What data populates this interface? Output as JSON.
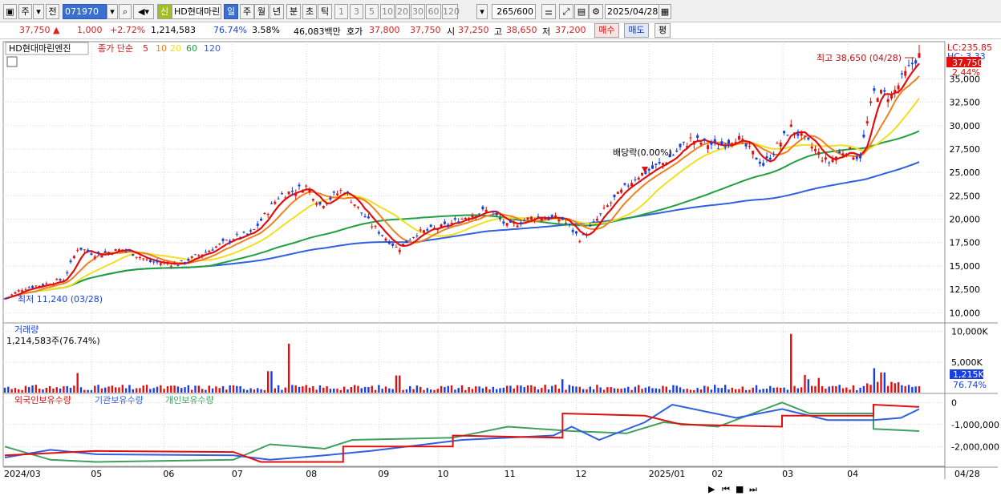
{
  "toolbar": {
    "period_label": "주",
    "prev_label": "전",
    "code": "071970",
    "stock_name": "HD현대마린",
    "badge_new": "신",
    "tabs": [
      "일",
      "주",
      "월",
      "년",
      "분",
      "초",
      "틱"
    ],
    "active_tab": "일",
    "intervals": [
      "1",
      "3",
      "5",
      "10",
      "20",
      "30",
      "60",
      "120"
    ],
    "count": "265",
    "count_total": "/600",
    "date": "2025/04/28"
  },
  "quote": {
    "price": "37,750",
    "change_arrow": "▲",
    "change": "1,000",
    "change_pct": "+2.72%",
    "volume": "1,214,583",
    "vol_ratio": "76.74%",
    "turnover": "3.58%",
    "amount": "46,083백만",
    "bid_label": "호가",
    "ask": "37,800",
    "bid": "37,750",
    "open_label": "시",
    "open": "37,250",
    "high_label": "고",
    "high": "38,650",
    "low_label": "저",
    "low": "37,200",
    "buy_button": "매수",
    "sell_button": "매도",
    "eval_button": "평"
  },
  "legend": {
    "title": "HD현대마린엔진",
    "ma_label": "종가 단순",
    "ma_periods": [
      "5",
      "10",
      "20",
      "60",
      "120"
    ],
    "ma_colors": [
      "#e01010",
      "#f08020",
      "#f0e020",
      "#20a040",
      "#3060e0"
    ]
  },
  "colors": {
    "up": "#e01010",
    "down": "#1a3fe0",
    "grid": "#d8d8d8",
    "foreign": "#e01010",
    "institution": "#3060e0",
    "individual": "#40a060"
  },
  "chart_data": [
    {
      "type": "candlestick",
      "title": "HD현대마린엔진",
      "ylim": [
        9000,
        38800
      ],
      "yticks": [
        "35,000",
        "32,500",
        "30,000",
        "27,500",
        "25,000",
        "22,500",
        "20,000",
        "17,500",
        "15,000",
        "12,500",
        "10,000"
      ],
      "ytick_values": [
        35000,
        32500,
        30000,
        27500,
        25000,
        22500,
        20000,
        17500,
        15000,
        12500,
        10000
      ],
      "x_months": [
        "2024/03",
        "05",
        "06",
        "07",
        "08",
        "09",
        "10",
        "11",
        "12",
        "2025/01",
        "02",
        "03",
        "04"
      ],
      "x_month_pos": [
        0.0,
        0.095,
        0.174,
        0.249,
        0.33,
        0.409,
        0.474,
        0.547,
        0.625,
        0.705,
        0.774,
        0.851,
        0.922
      ],
      "end_label": "04/28",
      "anchors": [
        [
          0.0,
          11500
        ],
        [
          0.02,
          12600
        ],
        [
          0.045,
          13100
        ],
        [
          0.065,
          13600
        ],
        [
          0.08,
          17000
        ],
        [
          0.1,
          16200
        ],
        [
          0.13,
          16800
        ],
        [
          0.16,
          15400
        ],
        [
          0.19,
          15200
        ],
        [
          0.22,
          16500
        ],
        [
          0.25,
          18000
        ],
        [
          0.27,
          18500
        ],
        [
          0.3,
          22500
        ],
        [
          0.33,
          23500
        ],
        [
          0.345,
          21500
        ],
        [
          0.37,
          23200
        ],
        [
          0.4,
          19500
        ],
        [
          0.43,
          16800
        ],
        [
          0.45,
          18500
        ],
        [
          0.48,
          19200
        ],
        [
          0.51,
          20500
        ],
        [
          0.53,
          21000
        ],
        [
          0.55,
          19200
        ],
        [
          0.58,
          20300
        ],
        [
          0.61,
          20000
        ],
        [
          0.63,
          17800
        ],
        [
          0.66,
          21500
        ],
        [
          0.69,
          24500
        ],
        [
          0.72,
          26000
        ],
        [
          0.75,
          28500
        ],
        [
          0.78,
          27800
        ],
        [
          0.8,
          28800
        ],
        [
          0.83,
          25800
        ],
        [
          0.86,
          29800
        ],
        [
          0.88,
          28000
        ],
        [
          0.9,
          26000
        ],
        [
          0.92,
          27500
        ],
        [
          0.935,
          26500
        ],
        [
          0.95,
          33500
        ],
        [
          0.97,
          33200
        ],
        [
          0.985,
          35500
        ],
        [
          1.0,
          37750
        ]
      ],
      "high": "38,650",
      "high_date": "04/28",
      "high_label": "최고 38,650 (04/28)",
      "low": "11,240",
      "low_date": "03/28",
      "low_label": "최저 11,240 (03/28)",
      "annotation": "배당락(0.00%)",
      "right_labels": [
        "LC:235.85",
        "HC: 3.33",
        "37,750",
        "2.44%"
      ]
    },
    {
      "type": "bar",
      "title": "거래량",
      "current": "1,214,583주(76.74%)",
      "yticks": [
        "10,000K",
        "5,000K"
      ],
      "ytick_values": [
        10000,
        5000
      ],
      "ylim": [
        0,
        11000
      ],
      "spikes": [
        [
          0.08,
          3200
        ],
        [
          0.31,
          8000
        ],
        [
          0.29,
          3500
        ],
        [
          0.43,
          2800
        ],
        [
          0.61,
          2200
        ],
        [
          0.86,
          9600
        ],
        [
          0.875,
          2900
        ],
        [
          0.89,
          2400
        ],
        [
          0.95,
          3500
        ],
        [
          0.96,
          2800
        ],
        [
          0.88,
          2200
        ]
      ],
      "current_value": "1,215K",
      "current_pct": "76.74%"
    },
    {
      "type": "line",
      "title": "외국인보유수량",
      "series_names": [
        "외국인보유수량",
        "기관보유수량",
        "개인보유수량"
      ],
      "yticks": [
        "0",
        "-1,000,000",
        "-2,000,000"
      ],
      "ytick_values": [
        0,
        -1000000,
        -2000000
      ],
      "ylim": [
        -2900000,
        300000
      ],
      "foreign": [
        [
          0.0,
          -2400000
        ],
        [
          0.1,
          -2200000
        ],
        [
          0.25,
          -2250000
        ],
        [
          0.28,
          -2700000
        ],
        [
          0.37,
          -2700000
        ],
        [
          0.37,
          -2000000
        ],
        [
          0.49,
          -2000000
        ],
        [
          0.49,
          -1500000
        ],
        [
          0.61,
          -1600000
        ],
        [
          0.61,
          -500000
        ],
        [
          0.7,
          -600000
        ],
        [
          0.74,
          -1000000
        ],
        [
          0.85,
          -1100000
        ],
        [
          0.85,
          -600000
        ],
        [
          0.95,
          -600000
        ],
        [
          0.95,
          -100000
        ],
        [
          1.0,
          -200000
        ]
      ],
      "institution": [
        [
          0.0,
          -2500000
        ],
        [
          0.05,
          -2150000
        ],
        [
          0.1,
          -2350000
        ],
        [
          0.25,
          -2400000
        ],
        [
          0.29,
          -2600000
        ],
        [
          0.35,
          -2400000
        ],
        [
          0.4,
          -2200000
        ],
        [
          0.5,
          -1700000
        ],
        [
          0.6,
          -1500000
        ],
        [
          0.62,
          -1100000
        ],
        [
          0.65,
          -1700000
        ],
        [
          0.7,
          -900000
        ],
        [
          0.73,
          -100000
        ],
        [
          0.8,
          -700000
        ],
        [
          0.85,
          -300000
        ],
        [
          0.9,
          -800000
        ],
        [
          0.95,
          -800000
        ],
        [
          0.98,
          -700000
        ],
        [
          1.0,
          -300000
        ]
      ],
      "individual": [
        [
          0.0,
          -2000000
        ],
        [
          0.05,
          -2600000
        ],
        [
          0.1,
          -2700000
        ],
        [
          0.25,
          -2600000
        ],
        [
          0.29,
          -1900000
        ],
        [
          0.35,
          -2100000
        ],
        [
          0.38,
          -1700000
        ],
        [
          0.49,
          -1600000
        ],
        [
          0.55,
          -1100000
        ],
        [
          0.62,
          -1300000
        ],
        [
          0.68,
          -1400000
        ],
        [
          0.72,
          -900000
        ],
        [
          0.78,
          -1100000
        ],
        [
          0.85,
          0
        ],
        [
          0.88,
          -500000
        ],
        [
          0.95,
          -500000
        ],
        [
          0.95,
          -1200000
        ],
        [
          1.0,
          -1300000
        ]
      ]
    }
  ],
  "bottom_toolbar": [
    "▶",
    "⏮",
    "■",
    "⏭"
  ]
}
